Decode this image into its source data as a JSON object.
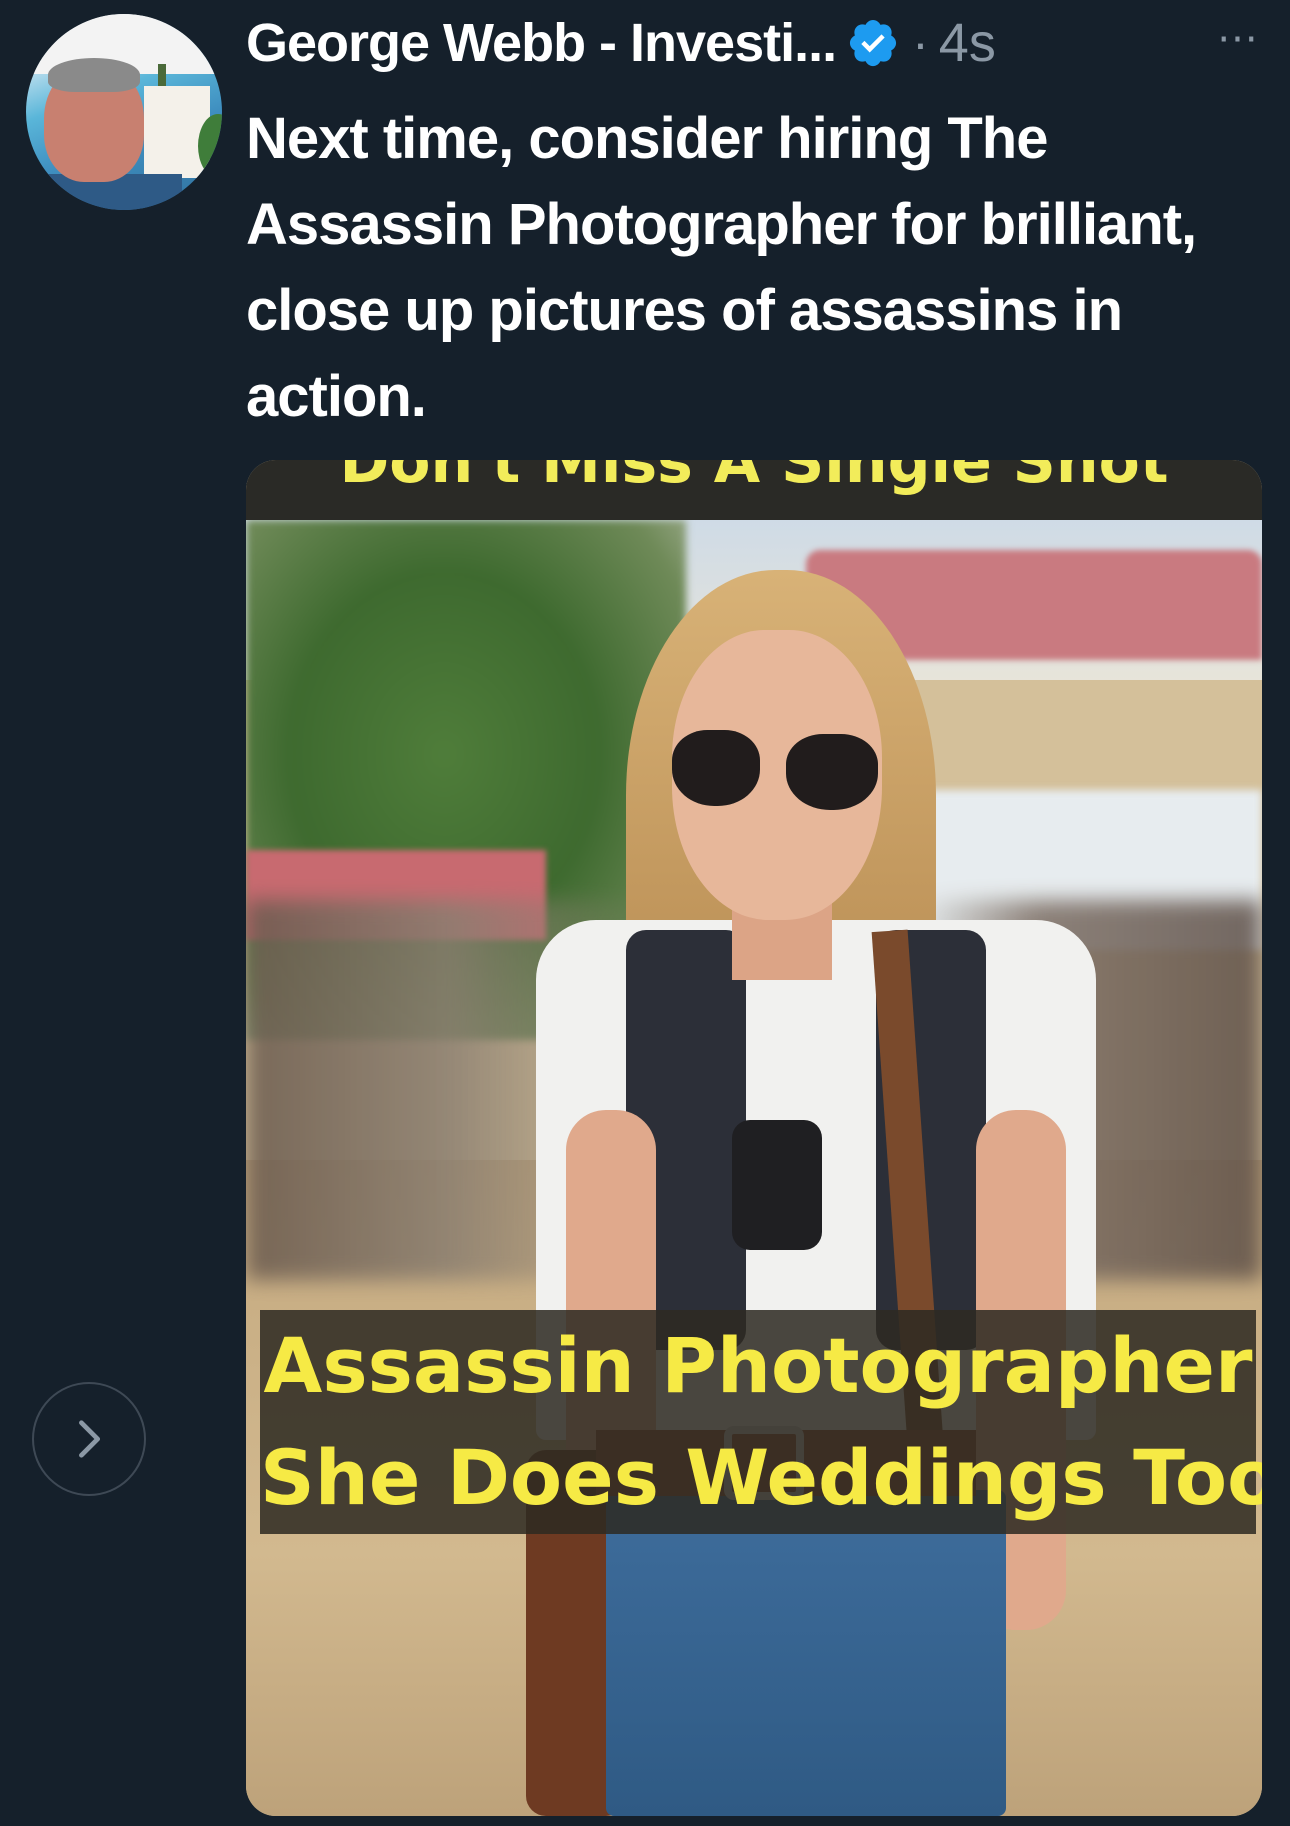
{
  "author": {
    "display_name": "George Webb - Investi...",
    "verified": true,
    "separator": "·",
    "timestamp": "4s"
  },
  "more_label": "···",
  "tweet": {
    "text": "Next time, consider hiring The Assassin Photographer for brilliant, close up pictures of assassins in action."
  },
  "media": {
    "top_caption": "Don't Miss A Single Shot",
    "caption_line1": "Assassin Photographer",
    "caption_line2": "She Does Weddings Too"
  },
  "colors": {
    "background": "#15202b",
    "text_primary": "#ffffff",
    "text_secondary": "#8b98a5",
    "verified_blue": "#1d9bf0",
    "caption_yellow": "#f6ea45"
  },
  "icons": {
    "verified": "verified-badge-icon",
    "more": "more-horizontal-icon",
    "next": "chevron-right-icon"
  }
}
